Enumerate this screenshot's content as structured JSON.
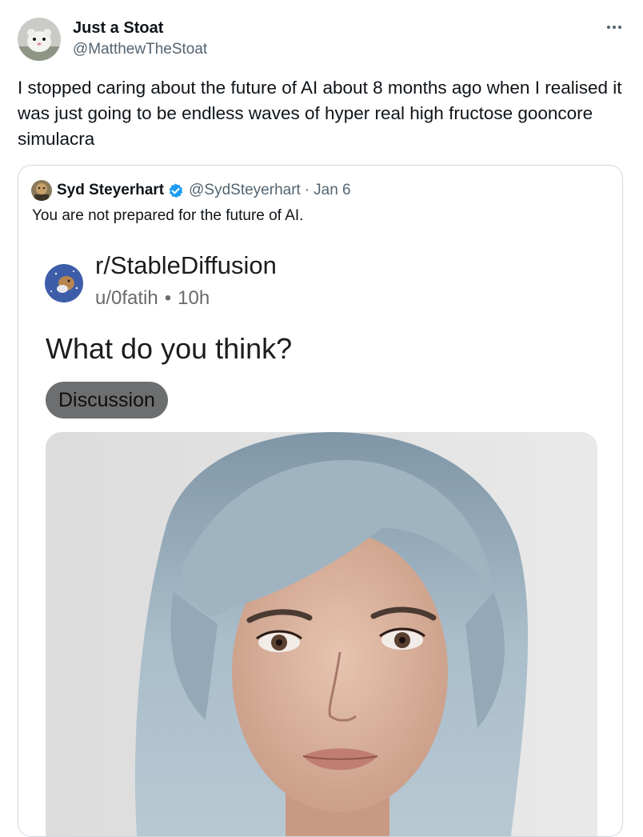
{
  "tweet": {
    "author_name": "Just a Stoat",
    "author_handle": "@MatthewTheStoat",
    "avatar_icon": "stoat-avatar-icon",
    "more_icon": "more-options-icon",
    "text": "I stopped caring about the future of AI about 8 months ago when I realised it was just going to be endless waves of hyper real high fructose gooncore simulacra"
  },
  "quote": {
    "author_name": "Syd Steyerhart",
    "author_handle": "@SydSteyerhart",
    "separator": "·",
    "date": "Jan 6",
    "verified_icon": "verified-badge-icon",
    "text": "You are not prepared for the future of AI.",
    "reddit_post": {
      "subreddit": "r/StableDiffusion",
      "username": "u/0fatih",
      "meta_separator": "•",
      "age": "10h",
      "title": "What do you think?",
      "flair": "Discussion",
      "image_icon": "portrait-image-icon"
    }
  },
  "colors": {
    "text_primary": "#0f1419",
    "text_secondary": "#536471",
    "border": "#cfd9de",
    "verified_blue": "#1d9bf0",
    "flair_bg": "#6d6e6f",
    "hair": "#a9bdca",
    "image_bg": "#e4e4e4"
  }
}
